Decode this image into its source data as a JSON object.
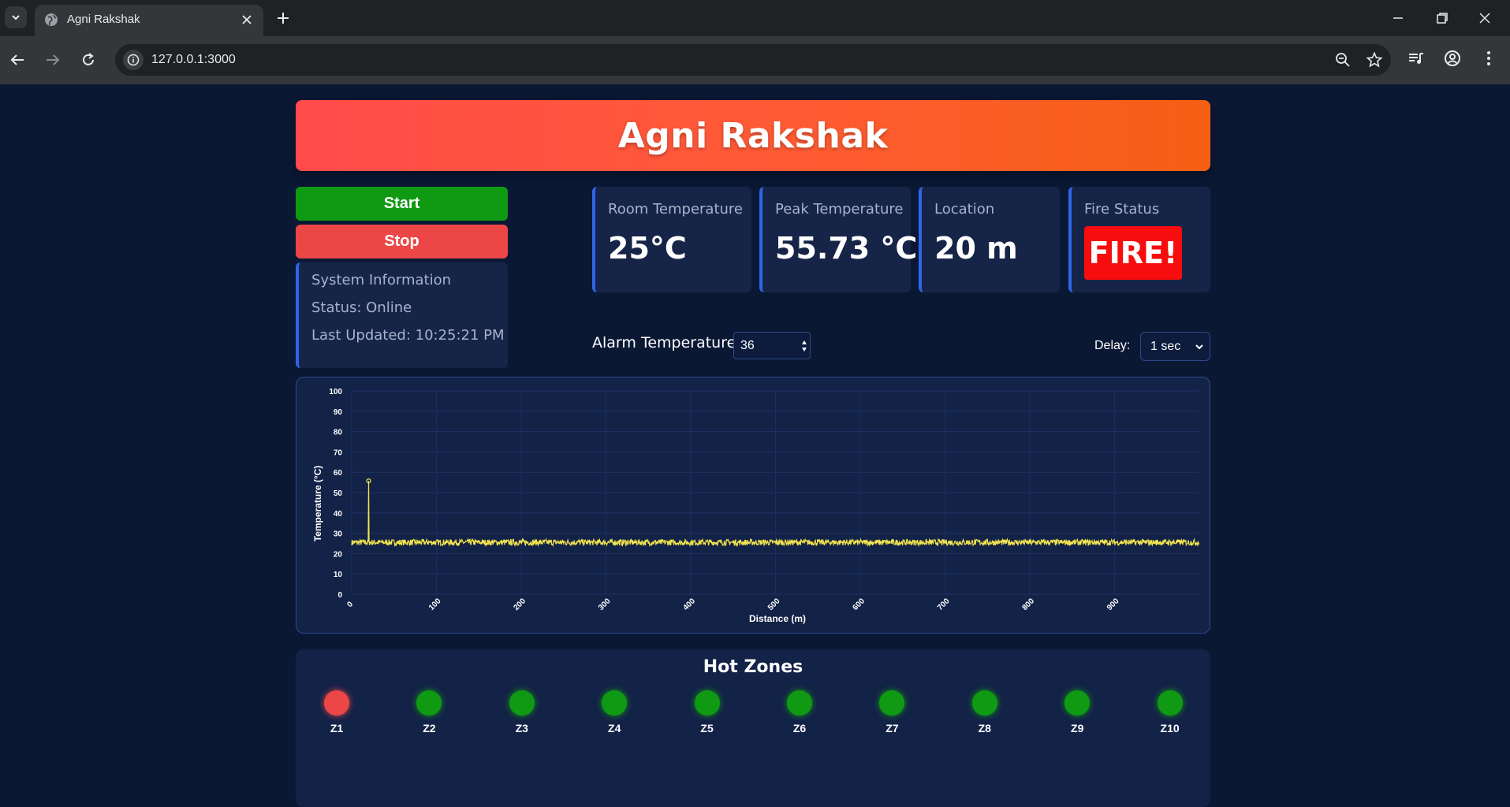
{
  "browser": {
    "tab_title": "Agni Rakshak",
    "url": "127.0.0.1:3000"
  },
  "app": {
    "title": "Agni Rakshak",
    "start_label": "Start",
    "stop_label": "Stop"
  },
  "system_info": {
    "heading": "System Information",
    "status": "Status: Online",
    "last_updated": "Last Updated: 10:25:21 PM"
  },
  "cards": {
    "room_temperature": {
      "label": "Room Temperature",
      "value": "25°C"
    },
    "peak_temperature": {
      "label": "Peak Temperature",
      "value": "55.73 °C"
    },
    "location": {
      "label": "Location",
      "value": "20 m"
    },
    "fire_status": {
      "label": "Fire Status",
      "value": "FIRE!"
    }
  },
  "controls": {
    "alarm_label": "Alarm Temperature:",
    "alarm_value": "36",
    "delay_label": "Delay:",
    "delay_value": "1 sec"
  },
  "chart_data": {
    "type": "line",
    "title": "",
    "xlabel": "Distance (m)",
    "ylabel": "Temperature (°C)",
    "xlim": [
      0,
      1000
    ],
    "ylim": [
      0,
      100
    ],
    "x_ticks": [
      "0",
      "100",
      "200",
      "300",
      "400",
      "500",
      "600",
      "700",
      "800",
      "900"
    ],
    "y_ticks": [
      "0",
      "10",
      "20",
      "30",
      "40",
      "50",
      "60",
      "70",
      "80",
      "90",
      "100"
    ],
    "series_color": "#f2e44e",
    "baseline_temperature": 25.5,
    "noise_amplitude": 1.5,
    "peak": {
      "x": 20,
      "y": 55.73
    },
    "grid": true,
    "legend": "none"
  },
  "hot_zones": {
    "title": "Hot Zones",
    "zones": [
      {
        "label": "Z1",
        "state": "hot"
      },
      {
        "label": "Z2",
        "state": "normal"
      },
      {
        "label": "Z3",
        "state": "normal"
      },
      {
        "label": "Z4",
        "state": "normal"
      },
      {
        "label": "Z5",
        "state": "normal"
      },
      {
        "label": "Z6",
        "state": "normal"
      },
      {
        "label": "Z7",
        "state": "normal"
      },
      {
        "label": "Z8",
        "state": "normal"
      },
      {
        "label": "Z9",
        "state": "normal"
      },
      {
        "label": "Z10",
        "state": "normal"
      }
    ],
    "colors": {
      "hot": "#ec4646",
      "normal": "#109a13"
    }
  },
  "icons": {
    "tab_list": "chevron-down-icon",
    "favicon": "globe-icon",
    "tab_close": "close-icon",
    "new_tab": "plus-icon",
    "back": "back-arrow-icon",
    "forward": "forward-arrow-icon",
    "reload": "reload-icon",
    "site_info": "info-icon",
    "zoom": "zoom-out-icon",
    "bookmark": "star-icon",
    "media": "media-queue-icon",
    "profile": "profile-icon",
    "menu": "kebab-menu-icon"
  }
}
